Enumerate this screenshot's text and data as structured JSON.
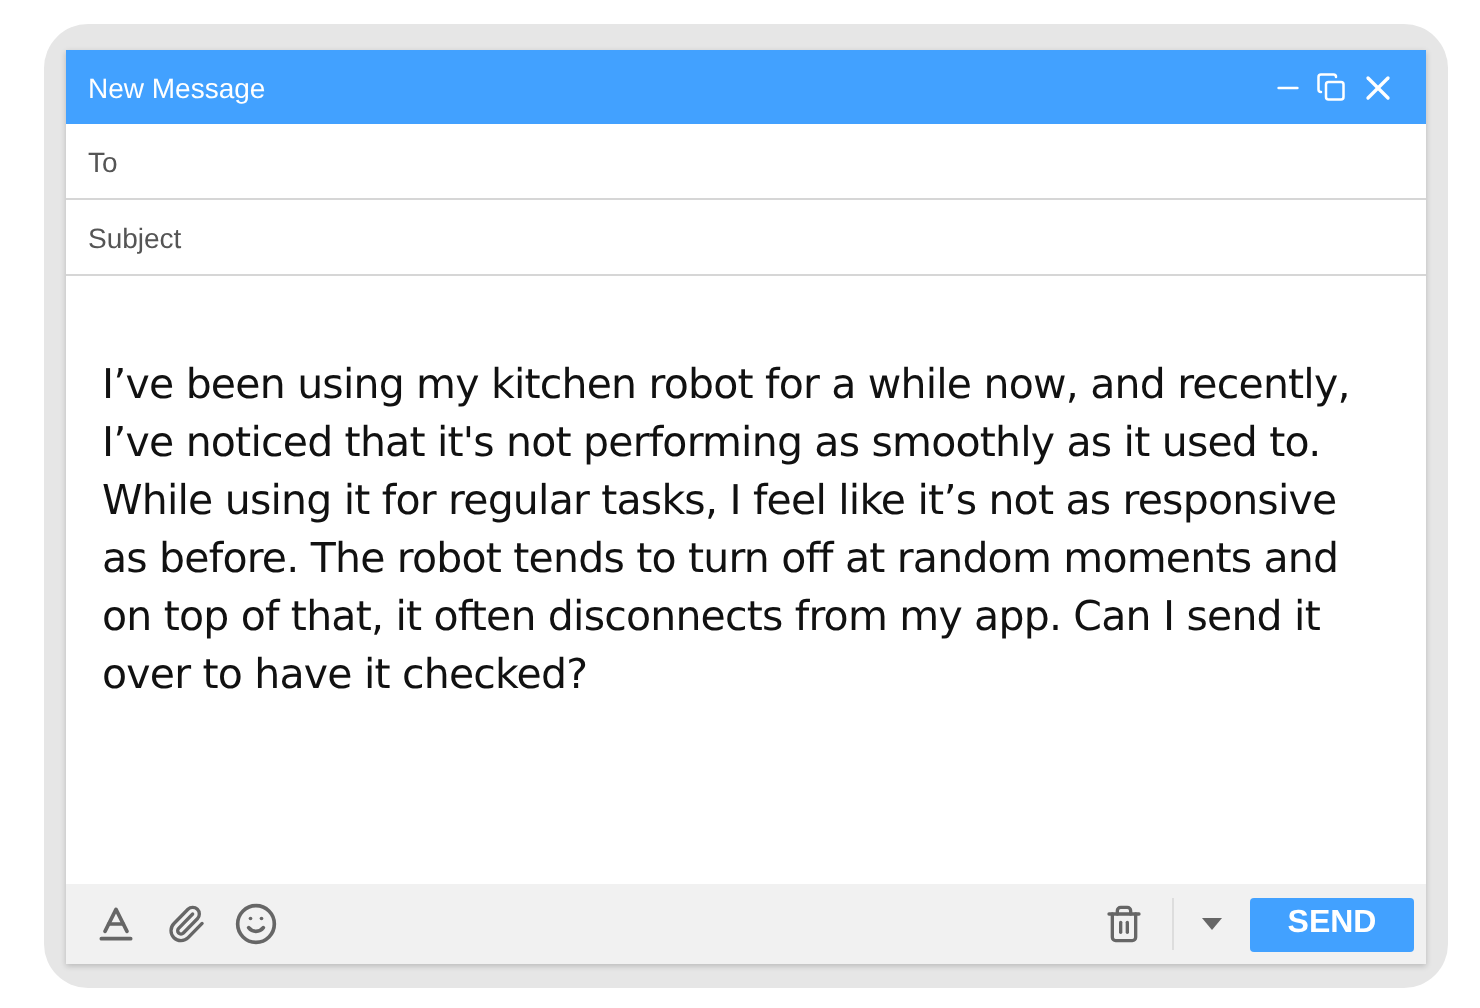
{
  "window": {
    "title": "New Message"
  },
  "fields": [
    {
      "placeholder": "To"
    },
    {
      "placeholder": "Subject"
    }
  ],
  "body": "I’ve been using my kitchen robot for a while now, and recently, I’ve noticed that it's not performing as smoothly as it used to. While using it for regular tasks, I feel like it’s not as responsive as before. The robot tends to turn off at random moments and on top of that, it often disconnects from my app. Can I send it over to have it checked?",
  "footer": {
    "send_button": "SEND"
  }
}
